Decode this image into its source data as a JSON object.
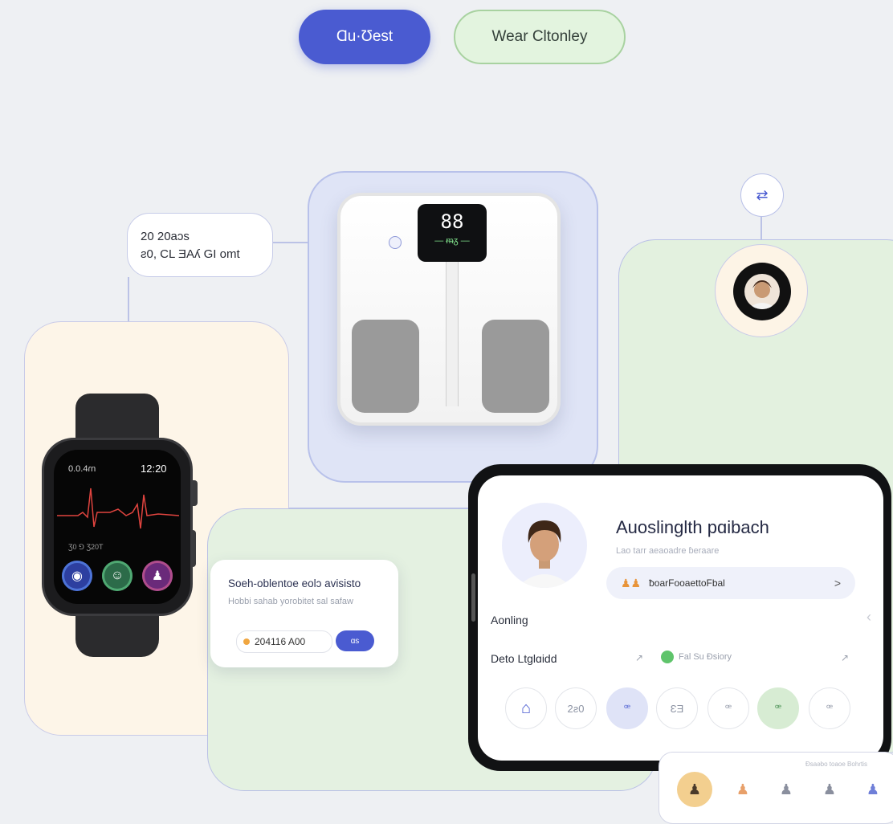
{
  "nav": {
    "primary_label": "Ɑu·Ʊest",
    "secondary_label": "Wear Cltonley"
  },
  "bubble": {
    "line1": "20 20aɔs",
    "line2": "ƨ0, CL ƎAʎ GI omt"
  },
  "scale": {
    "display_value": "88",
    "display_sub": "— ᵯᵹ —"
  },
  "watch": {
    "left_label": "0.0.4ɾn",
    "time": "12:20",
    "sub_label": "Ʒ0 ⅁ Ʒ20T",
    "complications": [
      {
        "icon": "globe-icon",
        "color": "#2d3fa0"
      },
      {
        "icon": "face-icon",
        "color": "#2c6b49"
      },
      {
        "icon": "person-icon",
        "color": "#6a2a7a"
      }
    ]
  },
  "card": {
    "title": "Soeh-oblentoe eolɔ avisisto",
    "subtitle": "Hobbi sahab yorobitet sal safaw",
    "value": "204116 A00",
    "button_label": "ɑs"
  },
  "tablet": {
    "title": "Auoslinglth pɑibach",
    "subtitle": "Lao tarr aeaoadre ɓeraare",
    "row_label": "ƀoarFooaettoFbal",
    "row_chevron": ">",
    "section1": "Aonling",
    "section2": "Deto Ltglɑidd",
    "section2_mid_label": "Fal Su Ɖsiory",
    "circles": [
      "⌂",
      "2ƨ0",
      "ꟹ",
      "ƐƎ",
      "ꟹ",
      "ꟹ",
      "ꟹ"
    ]
  },
  "bottombar": {
    "caption": "Ɖsaǝbo toaoe Bohɾtis"
  },
  "colors": {
    "accent": "#4a5bd1",
    "green": "#e3f1df",
    "peach": "#fdf5e8",
    "blue_panel": "#dfe4f6"
  }
}
